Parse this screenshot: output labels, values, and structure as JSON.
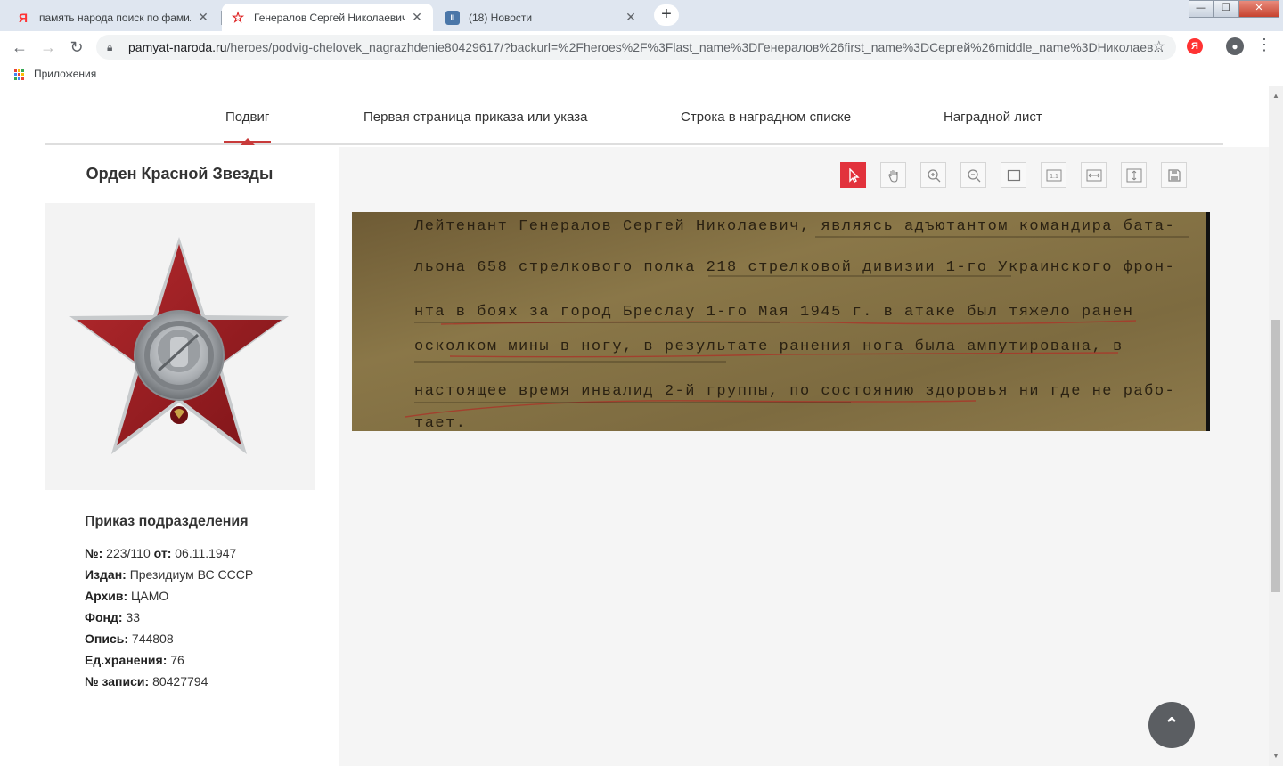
{
  "browser": {
    "tabs": [
      {
        "title": "память народа поиск по фамил",
        "favicon": "Я",
        "active": false
      },
      {
        "title": "Генералов Сергей Николаевич",
        "favicon": "☆",
        "active": true
      },
      {
        "title": "(18) Новости",
        "favicon": "II",
        "active": false
      }
    ],
    "window": {
      "min": "—",
      "max": "❐",
      "close": "✕"
    },
    "url": {
      "host": "pamyat-naroda.ru",
      "path": "/heroes/podvig-chelovek_nagrazhdenie80429617/?backurl=%2Fheroes%2F%3Flast_name%3DГенералов%26first_name%3DСергей%26middle_name%3DНиколаев..."
    },
    "extension_label": "Я",
    "bookmarks": {
      "apps_label": "Приложения"
    }
  },
  "nav": {
    "items": [
      "Подвиг",
      "Первая страница приказа или указа",
      "Строка в наградном списке",
      "Наградной лист"
    ],
    "active_index": 0
  },
  "award": {
    "title": "Орден Красной Звезды",
    "medal_colors": {
      "red": "#9c1d22",
      "silver": "#b8bcbf"
    }
  },
  "order": {
    "heading": "Приказ подразделения",
    "fields": [
      {
        "label": "№:",
        "value": "223/110",
        "label2": "от:",
        "value2": "06.11.1947"
      },
      {
        "label": "Издан:",
        "value": "Президиум ВС СССР"
      },
      {
        "label": "Архив:",
        "value": "ЦАМО"
      },
      {
        "label": "Фонд:",
        "value": "33"
      },
      {
        "label": "Опись:",
        "value": "744808"
      },
      {
        "label": "Ед.хранения:",
        "value": "76"
      },
      {
        "label": "№ записи:",
        "value": "80427794"
      }
    ]
  },
  "viewer": {
    "tools": [
      "pointer-icon",
      "hand-icon",
      "zoom-in-icon",
      "zoom-out-icon",
      "fit-page-icon",
      "actual-size-icon",
      "fit-width-icon",
      "fit-height-icon",
      "save-icon"
    ],
    "accent": "#e2323c",
    "document_lines": [
      "Лейтенант Генералов Сергей Николаевич, являясь адъютантом командира бата-",
      "льона 658 стрелкового полка 218 стрелковой дивизии 1-го Украинского фрон-",
      "нта в боях за город Бреслау 1-го Мая 1945 г. в атаке был тяжело ранен",
      "осколком мины в ногу, в результате ранения нога была ампутирована, в",
      "настоящее время инвалид 2-й группы, по состоянию здоровья ни где не рабо-",
      "тает."
    ]
  },
  "scroll_top_label": "⌃"
}
